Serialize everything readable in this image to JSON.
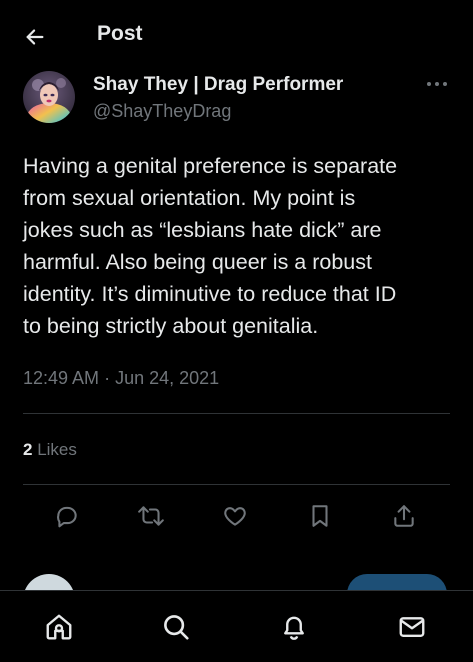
{
  "header": {
    "title": "Post",
    "back_icon": "arrow-left-icon"
  },
  "author": {
    "display_name": "Shay They | Drag Performer",
    "handle": "@ShayTheyDrag",
    "more_icon": "more-horizontal-icon"
  },
  "tweet": {
    "text": "Having a genital preference is separate\nfrom sexual orientation. My point is\njokes such as “lesbians hate dick” are\nharmful.  Also being queer is a robust\nidentity. It’s diminutive to reduce that ID\nto being strictly about genitalia.",
    "time": "12:49 AM",
    "separator": " · ",
    "date": "Jun 24, 2021"
  },
  "stats": {
    "likes_count": "2",
    "likes_label": " Likes"
  },
  "actions": [
    {
      "name": "reply",
      "icon": "comment-icon"
    },
    {
      "name": "repost",
      "icon": "repost-icon"
    },
    {
      "name": "like",
      "icon": "heart-icon"
    },
    {
      "name": "bookmark",
      "icon": "bookmark-icon"
    },
    {
      "name": "share",
      "icon": "share-icon"
    }
  ],
  "bottom_nav": [
    {
      "name": "home",
      "icon": "home-icon"
    },
    {
      "name": "search",
      "icon": "search-icon"
    },
    {
      "name": "notifications",
      "icon": "bell-icon"
    },
    {
      "name": "messages",
      "icon": "mail-icon"
    }
  ],
  "colors": {
    "background": "#000000",
    "text_primary": "#e7e9ea",
    "text_secondary": "#71767b",
    "divider": "#2f3336",
    "reply_button": "#1d4f76"
  }
}
